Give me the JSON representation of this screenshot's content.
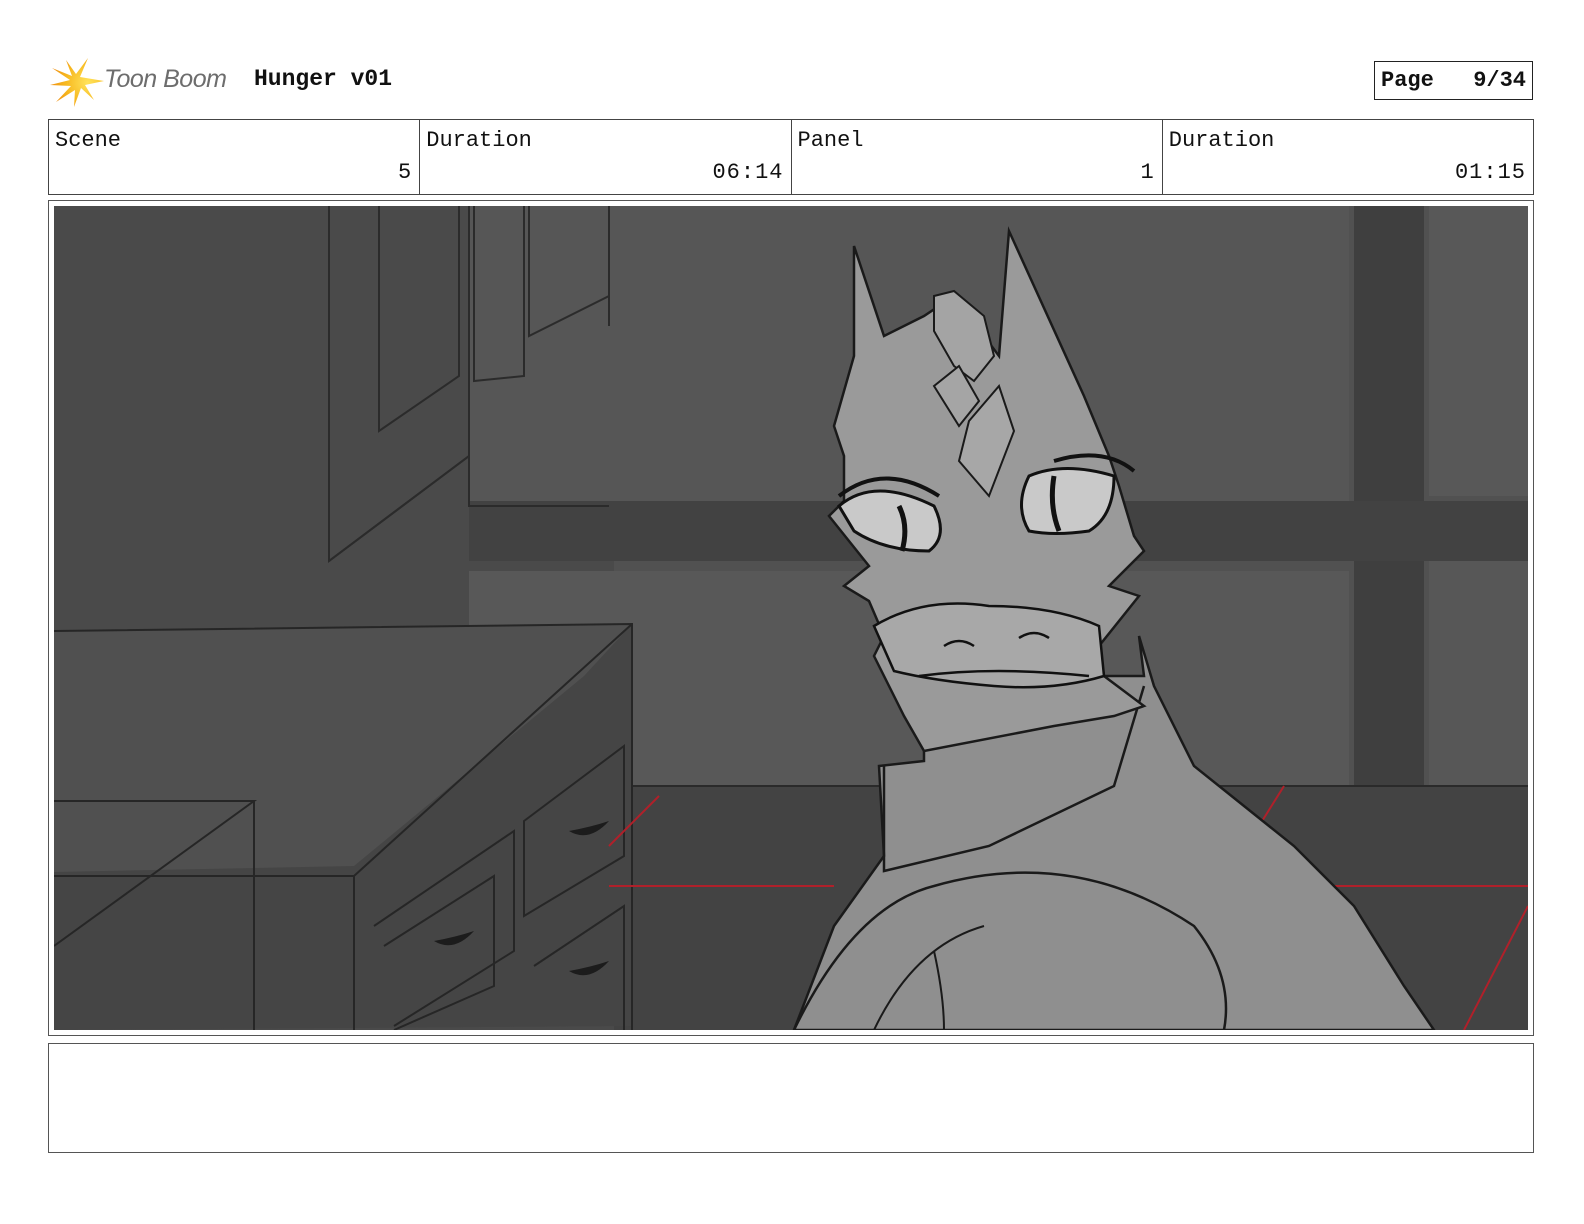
{
  "header": {
    "brand_name": "Toon Boom",
    "brand_icon": "toon-boom-burst-icon",
    "project_title": "Hunger v01",
    "page_label": "Page",
    "page_number": "9/34"
  },
  "info": {
    "scene_label": "Scene",
    "scene_value": "5",
    "scene_duration_label": "Duration",
    "scene_duration_value": "06:14",
    "panel_label": "Panel",
    "panel_value": "1",
    "panel_duration_label": "Duration",
    "panel_duration_value": "01:15"
  },
  "panel": {
    "drawing": "dragon-character-kitchen-sketch"
  },
  "notes": {
    "text": ""
  },
  "colors": {
    "logo_orange": "#f4a21b",
    "logo_yellow": "#f8d23a",
    "guide_red": "#b0202a"
  }
}
